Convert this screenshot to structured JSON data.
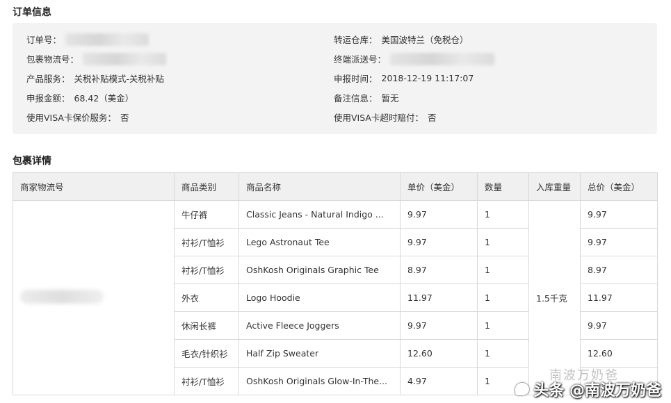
{
  "order_info": {
    "title": "订单信息",
    "left": [
      {
        "label": "订单号：",
        "value": "",
        "blurred": true,
        "blur_w": 120
      },
      {
        "label": "包裹物流号：",
        "value": "",
        "blurred": true,
        "blur_w": 120
      },
      {
        "label": "产品服务：",
        "value": "关税补贴模式-关税补贴"
      },
      {
        "label": "申报金额：",
        "value": "68.42（美金）"
      },
      {
        "label": "使用VISA卡保价服务：",
        "value": "否"
      }
    ],
    "right": [
      {
        "label": "转运仓库：",
        "value": "美国波特兰（免税仓）"
      },
      {
        "label": "终端派送号：",
        "value": "",
        "blurred": true,
        "blur_w": 150
      },
      {
        "label": "申报时间：",
        "value": "2018-12-19 11:17:07"
      },
      {
        "label": "备注信息：",
        "value": "暂无"
      },
      {
        "label": "使用VISA卡超时赔付：",
        "value": "否"
      }
    ]
  },
  "package_detail": {
    "title": "包裹详情",
    "columns": [
      "商家物流号",
      "商品类别",
      "商品名称",
      "单价（美金）",
      "数量",
      "入库重量",
      "总价（美金）"
    ],
    "weight": "1.5千克",
    "rows": [
      {
        "category": "牛仔裤",
        "name": "Classic Jeans - Natural Indigo ...",
        "price": "9.97",
        "qty": "1",
        "total": "9.97"
      },
      {
        "category": "衬衫/T恤衫",
        "name": "Lego Astronaut Tee",
        "price": "9.97",
        "qty": "1",
        "total": "9.97"
      },
      {
        "category": "衬衫/T恤衫",
        "name": "OshKosh Originals Graphic Tee",
        "price": "8.97",
        "qty": "1",
        "total": "8.97"
      },
      {
        "category": "外衣",
        "name": "Logo Hoodie",
        "price": "11.97",
        "qty": "1",
        "total": "11.97"
      },
      {
        "category": "休闲长裤",
        "name": "Active Fleece Joggers",
        "price": "9.97",
        "qty": "1",
        "total": "9.97"
      },
      {
        "category": "毛衣/针织衫",
        "name": "Half Zip Sweater",
        "price": "12.60",
        "qty": "1",
        "total": "12.60"
      },
      {
        "category": "衬衫/T恤衫",
        "name": "OshKosh Originals Glow-In-The...",
        "price": "4.97",
        "qty": "1",
        "total": ""
      }
    ]
  },
  "watermark": {
    "text": "头条 @南波万奶爸",
    "faint": "南波万奶爸"
  }
}
